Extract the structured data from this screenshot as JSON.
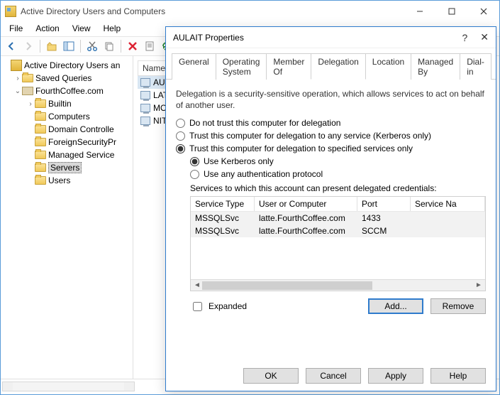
{
  "window": {
    "title": "Active Directory Users and Computers"
  },
  "menu": {
    "file": "File",
    "action": "Action",
    "view": "View",
    "help": "Help"
  },
  "tree": {
    "root": "Active Directory Users an",
    "items": [
      {
        "label": "Saved Queries",
        "expander": "›"
      },
      {
        "label": "FourthCoffee.com",
        "expander": "⌄",
        "children": [
          {
            "label": "Builtin",
            "expander": "›"
          },
          {
            "label": "Computers"
          },
          {
            "label": "Domain Controlle"
          },
          {
            "label": "ForeignSecurityPr"
          },
          {
            "label": "Managed Service"
          },
          {
            "label": "Servers",
            "selected": true
          },
          {
            "label": "Users"
          }
        ]
      }
    ]
  },
  "list": {
    "header": "Name",
    "rows": [
      {
        "name": "AULAIT",
        "selected": true
      },
      {
        "name": "LATTE"
      },
      {
        "name": "MOCHA"
      },
      {
        "name": "NITRO"
      }
    ]
  },
  "dialog": {
    "title": "AULAIT Properties",
    "tabs": {
      "general": "General",
      "os": "Operating System",
      "memberof": "Member Of",
      "delegation": "Delegation",
      "location": "Location",
      "managedby": "Managed By",
      "dialin": "Dial-in"
    },
    "description": "Delegation is a security-sensitive operation, which allows services to act on behalf of another user.",
    "radios": {
      "r1": "Do not trust this computer for delegation",
      "r2": "Trust this computer for delegation to any service (Kerberos only)",
      "r3": "Trust this computer for delegation to specified services only",
      "sub1": "Use Kerberos only",
      "sub2": "Use any authentication protocol"
    },
    "services_label": "Services to which this account can present delegated credentials:",
    "table": {
      "headers": {
        "c1": "Service Type",
        "c2": "User or Computer",
        "c3": "Port",
        "c4": "Service Na"
      },
      "rows": [
        {
          "type": "MSSQLSvc",
          "uc": "latte.FourthCoffee.com",
          "port": "1433",
          "sn": ""
        },
        {
          "type": "MSSQLSvc",
          "uc": "latte.FourthCoffee.com",
          "port": "SCCM",
          "sn": ""
        }
      ]
    },
    "expanded": "Expanded",
    "add": "Add...",
    "remove": "Remove",
    "ok": "OK",
    "cancel": "Cancel",
    "apply": "Apply",
    "help": "Help"
  }
}
